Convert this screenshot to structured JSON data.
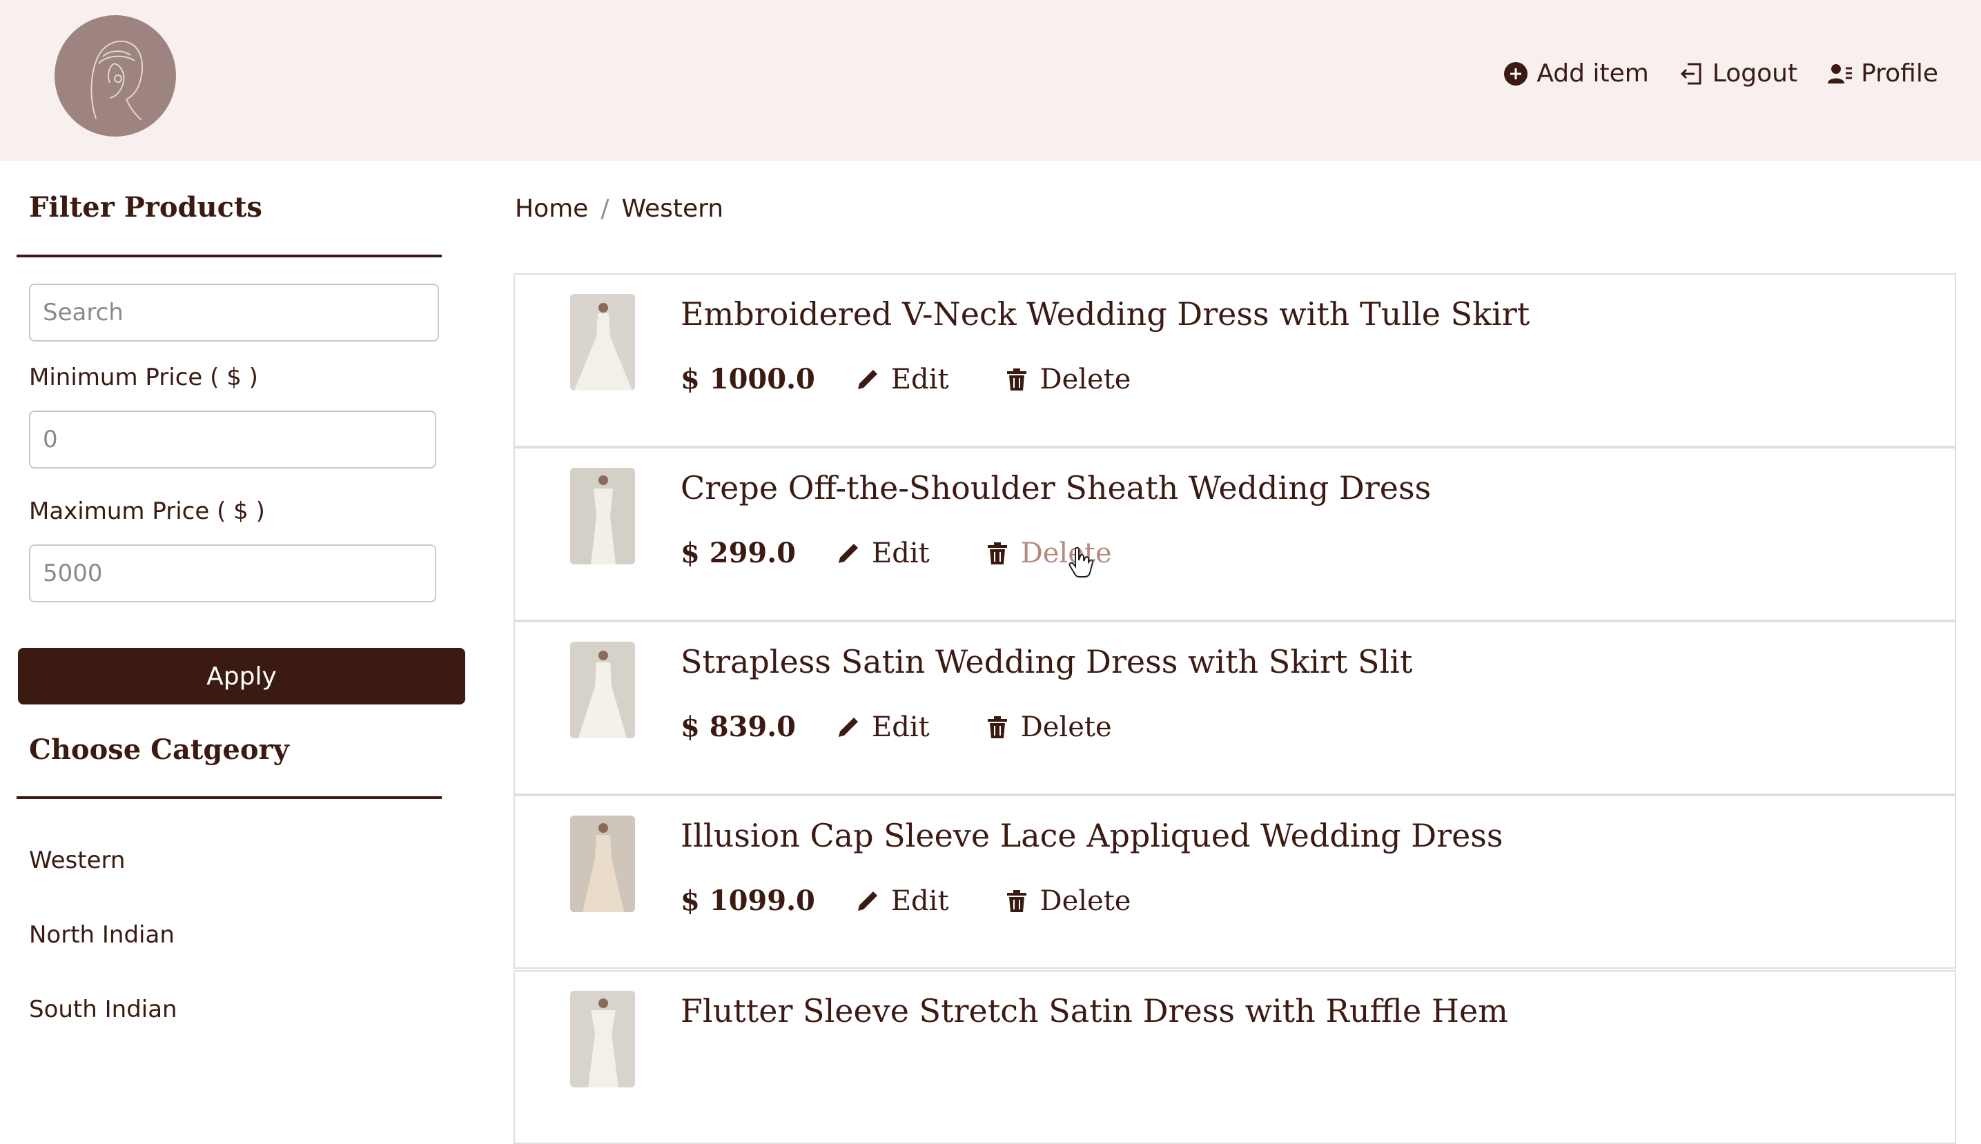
{
  "header": {
    "nav": [
      {
        "label": "Add item",
        "icon": "plus-circle-icon"
      },
      {
        "label": "Logout",
        "icon": "logout-icon"
      },
      {
        "label": "Profile",
        "icon": "user-list-icon"
      }
    ]
  },
  "sidebar": {
    "filter_title": "Filter Products",
    "search_placeholder": "Search",
    "min_label": "Minimum Price ( $ )",
    "min_value": "0",
    "max_label": "Maximum Price ( $ )",
    "max_value": "5000",
    "apply_label": "Apply",
    "category_title": "Choose Catgeory",
    "categories": [
      "Western",
      "North Indian",
      "South Indian"
    ]
  },
  "breadcrumb": {
    "home": "Home",
    "separator": "/",
    "current": "Western"
  },
  "products": [
    {
      "title": "Embroidered V-Neck Wedding Dress with Tulle Skirt",
      "price": "$ 1000.0",
      "edit": "Edit",
      "delete": "Delete"
    },
    {
      "title": "Crepe Off-the-Shoulder Sheath Wedding Dress",
      "price": "$ 299.0",
      "edit": "Edit",
      "delete": "Delete"
    },
    {
      "title": "Strapless Satin Wedding Dress with Skirt Slit",
      "price": "$ 839.0",
      "edit": "Edit",
      "delete": "Delete"
    },
    {
      "title": "Illusion Cap Sleeve Lace Appliqued Wedding Dress",
      "price": "$ 1099.0",
      "edit": "Edit",
      "delete": "Delete"
    },
    {
      "title": "Flutter Sleeve Stretch Satin Dress with Ruffle Hem"
    }
  ],
  "colors": {
    "brand": "#3b1a12",
    "header_bg": "#f7f0ef",
    "hover": "#b48a80"
  }
}
